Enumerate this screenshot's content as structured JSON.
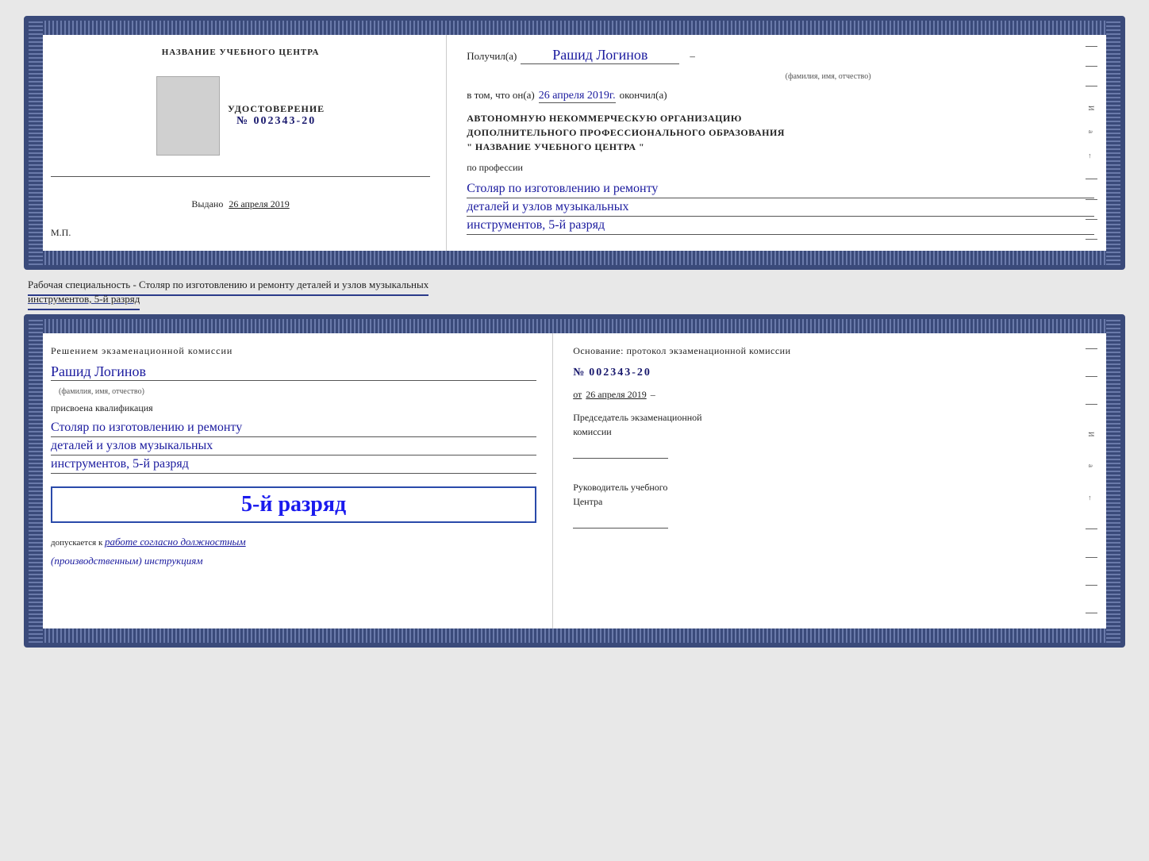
{
  "top_cert": {
    "left": {
      "center_title": "НАЗВАНИЕ УЧЕБНОГО ЦЕНТРА",
      "udostoverenie_label": "УДОСТОВЕРЕНИЕ",
      "number_prefix": "№",
      "number": "002343-20",
      "vydano_label": "Выдано",
      "vydano_date": "26 апреля 2019",
      "mp_label": "М.П."
    },
    "right": {
      "poluchil_label": "Получил(а)",
      "recipient_name": "Рашид Логинов",
      "fio_label": "(фамилия, имя, отчество)",
      "vtom_label": "в том, что он(а)",
      "date_value": "26 апреля 2019г.",
      "okonchil_label": "окончил(а)",
      "org_line1": "АВТОНОМНУЮ НЕКОММЕРЧЕСКУЮ ОРГАНИЗАЦИЮ",
      "org_line2": "ДОПОЛНИТЕЛЬНОГО ПРОФЕССИОНАЛЬНОГО ОБРАЗОВАНИЯ",
      "org_line3": "\"  НАЗВАНИЕ УЧЕБНОГО ЦЕНТРА  \"",
      "po_professii_label": "по профессии",
      "profession_line1": "Столяр по изготовлению и ремонту",
      "profession_line2": "деталей и узлов музыкальных",
      "profession_line3": "инструментов, 5-й разряд"
    }
  },
  "specialty_label": "Рабочая специальность - Столяр по изготовлению и ремонту деталей и узлов музыкальных",
  "specialty_label2": "инструментов, 5-й разряд",
  "bottom_cert": {
    "left": {
      "resheniem_text": "Решением  экзаменационной  комиссии",
      "recipient_name": "Рашид Логинов",
      "fio_label": "(фамилия, имя, отчество)",
      "prisvoena_label": "присвоена квалификация",
      "profession_line1": "Столяр по изготовлению и ремонту",
      "profession_line2": "деталей и узлов музыкальных",
      "profession_line3": "инструментов, 5-й разряд",
      "razryad_label": "5-й разряд",
      "dopuskaetsya_label": "допускается к",
      "rabota_text": "работе согласно должностным",
      "instruktsii_text": "(производственным) инструкциям"
    },
    "right": {
      "osnovanie_label": "Основание: протокол экзаменационной  комиссии",
      "number_prefix": "№",
      "number": "002343-20",
      "ot_label": "от",
      "date_value": "26 апреля 2019",
      "predsedatel_line1": "Председатель экзаменационной",
      "predsedatel_line2": "комиссии",
      "rukovoditel_line1": "Руководитель учебного",
      "rukovoditel_line2": "Центра"
    }
  },
  "deco": {
    "right_chars": [
      "–",
      "–",
      "–",
      "И",
      "а",
      "←",
      "–",
      "–",
      "–",
      "–"
    ]
  }
}
